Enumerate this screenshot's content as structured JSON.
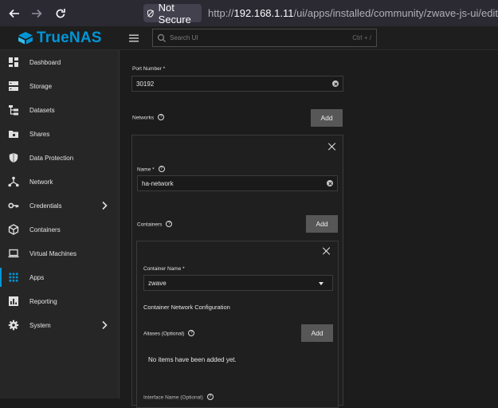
{
  "browser": {
    "security_label": "Not Secure",
    "url_prefix": "http://",
    "url_host": "192.168.1.11",
    "url_path": "/ui/apps/installed/community/zwave-js-ui/edit"
  },
  "header": {
    "logo_text": "TrueNAS",
    "search_placeholder": "Search UI",
    "search_shortcut": "Ctrl + /"
  },
  "sidebar": {
    "items": [
      {
        "label": "Dashboard",
        "icon": "dashboard-icon"
      },
      {
        "label": "Storage",
        "icon": "storage-icon"
      },
      {
        "label": "Datasets",
        "icon": "datasets-icon"
      },
      {
        "label": "Shares",
        "icon": "shares-icon"
      },
      {
        "label": "Data Protection",
        "icon": "shield-icon"
      },
      {
        "label": "Network",
        "icon": "network-icon"
      },
      {
        "label": "Credentials",
        "icon": "key-icon"
      },
      {
        "label": "Containers",
        "icon": "containers-icon"
      },
      {
        "label": "Virtual Machines",
        "icon": "laptop-icon"
      },
      {
        "label": "Apps",
        "icon": "apps-grid-icon"
      },
      {
        "label": "Reporting",
        "icon": "reporting-icon"
      },
      {
        "label": "System",
        "icon": "gear-icon"
      }
    ],
    "accent": "#0095d5"
  },
  "form": {
    "port_label": "Port Number *",
    "port_value": "30192",
    "networks_label": "Networks",
    "add_label": "Add",
    "network_name_label": "Name *",
    "network_name_value": "ha-network",
    "containers_label": "Containers",
    "container_name_label": "Container Name *",
    "container_name_value": "zwave",
    "container_network_config_label": "Container Network Configuration",
    "aliases_label": "Aliases (Optional)",
    "aliases_empty": "No items have been added yet.",
    "interface_name_label": "Interface Name (Optional)"
  },
  "help_glyph": "?"
}
